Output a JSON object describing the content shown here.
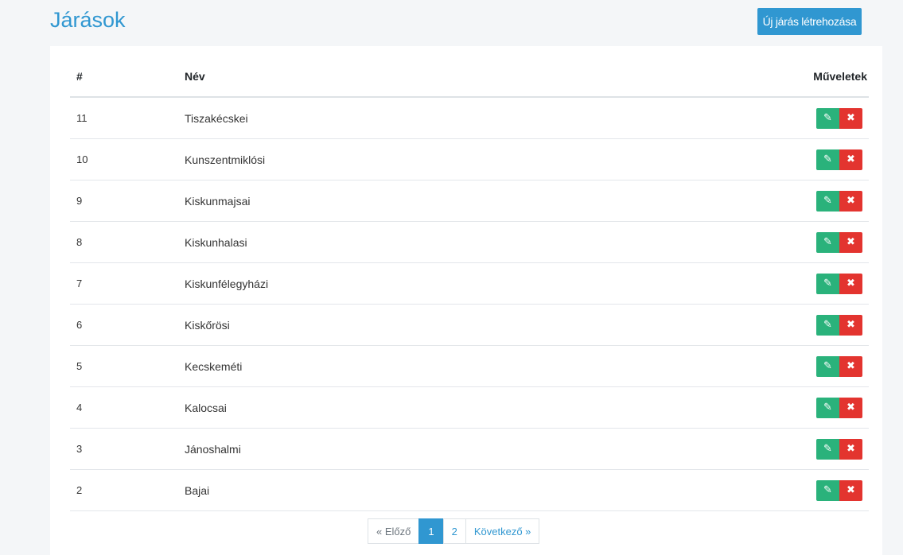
{
  "header": {
    "title": "Járások",
    "new_button_label": "Új járás létrehozása"
  },
  "table": {
    "columns": [
      "#",
      "Név",
      "Műveletek"
    ],
    "rows": [
      {
        "id": "11",
        "name": "Tiszakécskei"
      },
      {
        "id": "10",
        "name": "Kunszentmiklósi"
      },
      {
        "id": "9",
        "name": "Kiskunmajsai"
      },
      {
        "id": "8",
        "name": "Kiskunhalasi"
      },
      {
        "id": "7",
        "name": "Kiskunfélegyházi"
      },
      {
        "id": "6",
        "name": "Kiskőrösi"
      },
      {
        "id": "5",
        "name": "Kecskeméti"
      },
      {
        "id": "4",
        "name": "Kalocsai"
      },
      {
        "id": "3",
        "name": "Jánoshalmi"
      },
      {
        "id": "2",
        "name": "Bajai"
      }
    ]
  },
  "actions": {
    "edit_icon": "pencil-icon",
    "delete_icon": "close-icon",
    "edit_color": "#2ab27b",
    "delete_color": "#e3342f"
  },
  "pagination": {
    "prev_label": "« Előző",
    "pages": [
      "1",
      "2"
    ],
    "active_page": "1",
    "next_label": "Következő »"
  },
  "colors": {
    "accent": "#3097d1"
  }
}
